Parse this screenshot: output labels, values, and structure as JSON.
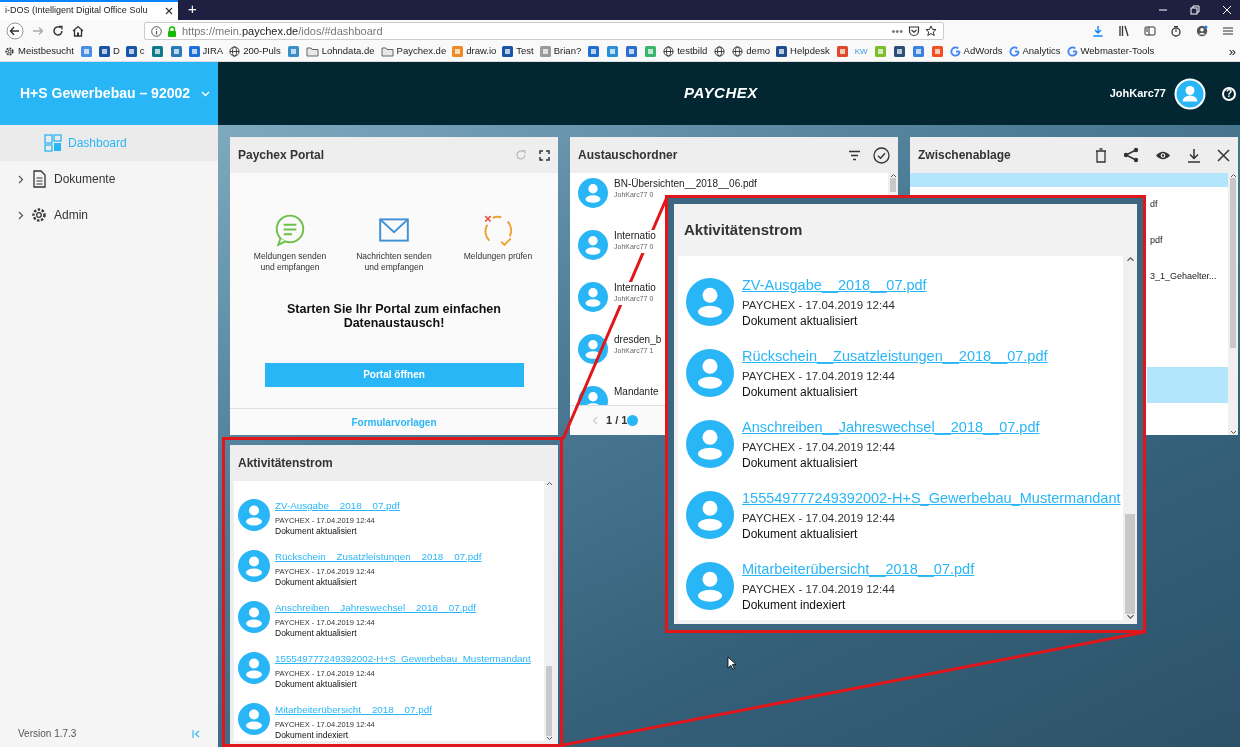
{
  "browser": {
    "tab": {
      "title": "i-DOS (Intelligent Digital Office Solu"
    },
    "new_tab": "+",
    "url": "https://mein.**paychex.de**/idos/#dashboard",
    "page_actions": "•••",
    "bookmarks": [
      {
        "kind": "gear",
        "label": "Meistbesucht"
      },
      {
        "kind": "tile",
        "color": "#4a90e2"
      },
      {
        "kind": "tile",
        "color": "#1a56a8",
        "label": "D"
      },
      {
        "kind": "tile",
        "color": "#1a56a8",
        "label": "c"
      },
      {
        "kind": "tile",
        "color": "#0f7b8a"
      },
      {
        "kind": "tile",
        "color": "#2a7ab8"
      },
      {
        "kind": "tile",
        "color": "#1e6fd9",
        "label": "JIRA"
      },
      {
        "kind": "globe",
        "label": "200-Puls"
      },
      {
        "kind": "tile",
        "color": "#3a8fc9"
      },
      {
        "kind": "folder",
        "label": "Lohndata.de"
      },
      {
        "kind": "folder",
        "label": "Paychex.de"
      },
      {
        "kind": "tile",
        "color": "#f08a24",
        "label": "draw.io"
      },
      {
        "kind": "tile",
        "color": "#1a56a8",
        "label": "Test"
      },
      {
        "kind": "tile",
        "color": "#9a9a9a",
        "label": "Brian?"
      },
      {
        "kind": "tile",
        "color": "#1f6fd0"
      },
      {
        "kind": "tile",
        "color": "#2a8fd9"
      },
      {
        "kind": "tile",
        "color": "#2a6fd0"
      },
      {
        "kind": "tile",
        "color": "#3bb56b"
      },
      {
        "kind": "globe",
        "label": "testbild"
      },
      {
        "kind": "globe"
      },
      {
        "kind": "globe",
        "label": "demo"
      },
      {
        "kind": "tile",
        "color": "#1d4f91",
        "label": "Helpdesk"
      },
      {
        "kind": "tile",
        "color": "#e04a2a"
      },
      {
        "kind": "text",
        "label": "KW"
      },
      {
        "kind": "tile",
        "color": "#7cbf2a"
      },
      {
        "kind": "tile",
        "color": "#2b4f7a"
      },
      {
        "kind": "tile",
        "color": "#3b82e0"
      },
      {
        "kind": "tile",
        "color": "#f25022"
      },
      {
        "kind": "google",
        "label": "AdWords"
      },
      {
        "kind": "google",
        "label": "Analytics"
      },
      {
        "kind": "google",
        "label": "Webmaster-Tools"
      }
    ],
    "overflow": "»"
  },
  "app": {
    "company": "H+S Gewerbebau – 92002",
    "logo": "PAYCHEX",
    "user": "JohKarc77",
    "help": "?"
  },
  "sidebar": {
    "items": [
      {
        "label": "Dashboard",
        "kind": "link",
        "selected": true
      },
      {
        "label": "Dokumente",
        "kind": "group",
        "selected": false
      },
      {
        "label": "Admin",
        "kind": "group",
        "selected": false
      }
    ],
    "version": "Version 1.7.3"
  },
  "portal": {
    "title": "Paychex Portal",
    "features": [
      {
        "label": "Meldungen senden\nund empfangen"
      },
      {
        "label": "Nachrichten senden\nund empfangen"
      },
      {
        "label": "Meldungen prüfen"
      }
    ],
    "headline": "Starten Sie Ihr Portal zum einfachen\nDatenaustausch!",
    "button": "Portal öffnen",
    "footer_link": "Formularvorlagen"
  },
  "exchange": {
    "title": "Austauschordner",
    "items": [
      {
        "name": "BN-Übersichten__2018__06.pdf",
        "meta": "JohKarc77 0"
      },
      {
        "name": "Internatio",
        "meta": "JohKarc77 0"
      },
      {
        "name": "Internatio",
        "meta": "JohKarc77 0"
      },
      {
        "name": "dresden_b",
        "meta": "JohKarc77 1"
      },
      {
        "name": "Mandante"
      }
    ],
    "pager": "1 / 1"
  },
  "clipboard": {
    "title": "Zwischenablage",
    "rows": [
      {
        "selected": true
      },
      {
        "name": "df",
        "selected": false
      },
      {
        "name": "pdf",
        "selected": false
      },
      {
        "name": "3_1_Gehaelter...",
        "selected": false
      },
      {
        "selected": false
      },
      {
        "selected": false
      },
      {
        "selected": true
      },
      {
        "selected": false
      }
    ]
  },
  "activity": {
    "title": "Aktivitätenstrom",
    "items": [
      {
        "file": "ZV-Ausgabe__2018__07.pdf",
        "meta": "PAYCHEX - 17.04.2019 12:44",
        "status": "Dokument aktualisiert"
      },
      {
        "file": "Rückschein__Zusatzleistungen__2018__07.pdf",
        "meta": "PAYCHEX - 17.04.2019 12:44",
        "status": "Dokument aktualisiert"
      },
      {
        "file": "Anschreiben__Jahreswechsel__2018__07.pdf",
        "meta": "PAYCHEX - 17.04.2019 12:44",
        "status": "Dokument aktualisiert"
      },
      {
        "file": "155549777249392002-H+S_Gewerbebau_Mustermandant",
        "meta": "PAYCHEX - 17.04.2019 12:44",
        "status": "Dokument aktualisiert"
      },
      {
        "file": "Mitarbeiterübersicht__2018__07.pdf",
        "meta": "PAYCHEX - 17.04.2019 12:44",
        "status": "Dokument indexiert"
      }
    ]
  },
  "activity_zoom": {
    "title": "Aktivitätenstrom",
    "items": [
      {
        "file": "ZV-Ausgabe__2018__07.pdf",
        "meta": "PAYCHEX - 17.04.2019 12:44",
        "status": "Dokument aktualisiert"
      },
      {
        "file": "Rückschein__Zusatzleistungen__2018__07.pdf",
        "meta": "PAYCHEX - 17.04.2019 12:44",
        "status": "Dokument aktualisiert"
      },
      {
        "file": "Anschreiben__Jahreswechsel__2018__07.pdf",
        "meta": "PAYCHEX - 17.04.2019 12:44",
        "status": "Dokument aktualisiert"
      },
      {
        "file": "155549777249392002-H+S_Gewerbebau_Mustermandant",
        "meta": "PAYCHEX - 17.04.2019 12:44",
        "status": "Dokument aktualisiert"
      },
      {
        "file": "Mitarbeiterübersicht__2018__07.pdf",
        "meta": "PAYCHEX - 17.04.2019 12:44",
        "status": "Dokument indexiert"
      }
    ]
  }
}
